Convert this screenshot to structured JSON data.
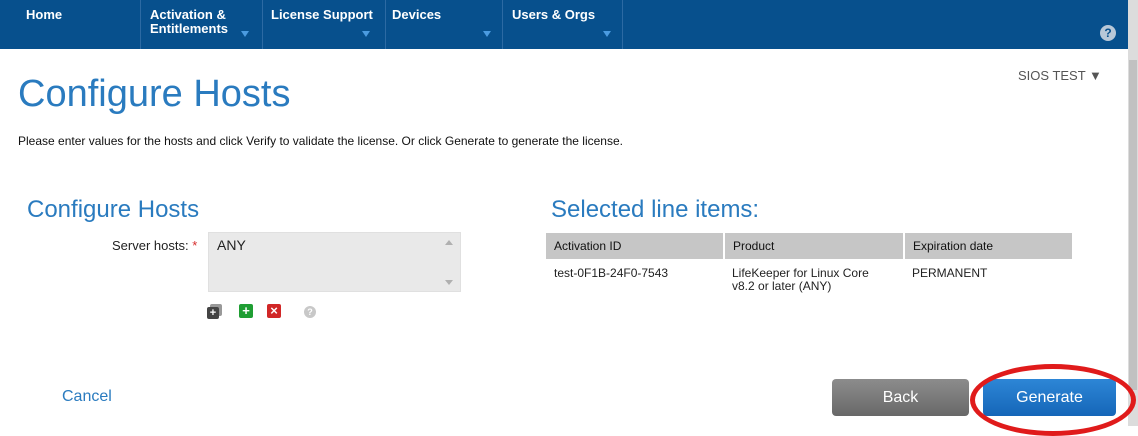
{
  "nav": {
    "items": [
      {
        "line1": "Home",
        "line2": ""
      },
      {
        "line1": "Activation &",
        "line2": "Entitlements"
      },
      {
        "line1": "License Support",
        "line2": ""
      },
      {
        "line1": "Devices",
        "line2": ""
      },
      {
        "line1": "Users & Orgs",
        "line2": ""
      }
    ],
    "help_glyph": "?"
  },
  "account": {
    "label": "SIOS TEST ▼"
  },
  "page": {
    "title": "Configure Hosts",
    "instructions": "Please enter values for the hosts and click Verify to validate the license. Or click Generate to generate the license."
  },
  "configure": {
    "section_title": "Configure Hosts",
    "server_hosts_label": "Server hosts:",
    "required_marker": "*",
    "server_hosts_value": "ANY"
  },
  "line_items": {
    "section_title": "Selected line items:",
    "columns": [
      "Activation ID",
      "Product",
      "Expiration date"
    ],
    "rows": [
      {
        "activation_id": "test-0F1B-24F0-7543",
        "product_line1": "LifeKeeper for Linux Core",
        "product_line2": "v8.2 or later (ANY)",
        "expiration": "PERMANENT"
      }
    ]
  },
  "actions": {
    "cancel_label": "Cancel",
    "back_label": "Back",
    "generate_label": "Generate"
  },
  "colors": {
    "nav_background": "#07508d",
    "title_blue": "#2a7bbf",
    "generate_button": "#1a6fc2",
    "back_button": "#7a7a7a",
    "highlight_ring": "#e01b1b"
  },
  "icons": [
    "help-icon",
    "expand-icon",
    "add-icon",
    "remove-icon",
    "info-icon"
  ]
}
